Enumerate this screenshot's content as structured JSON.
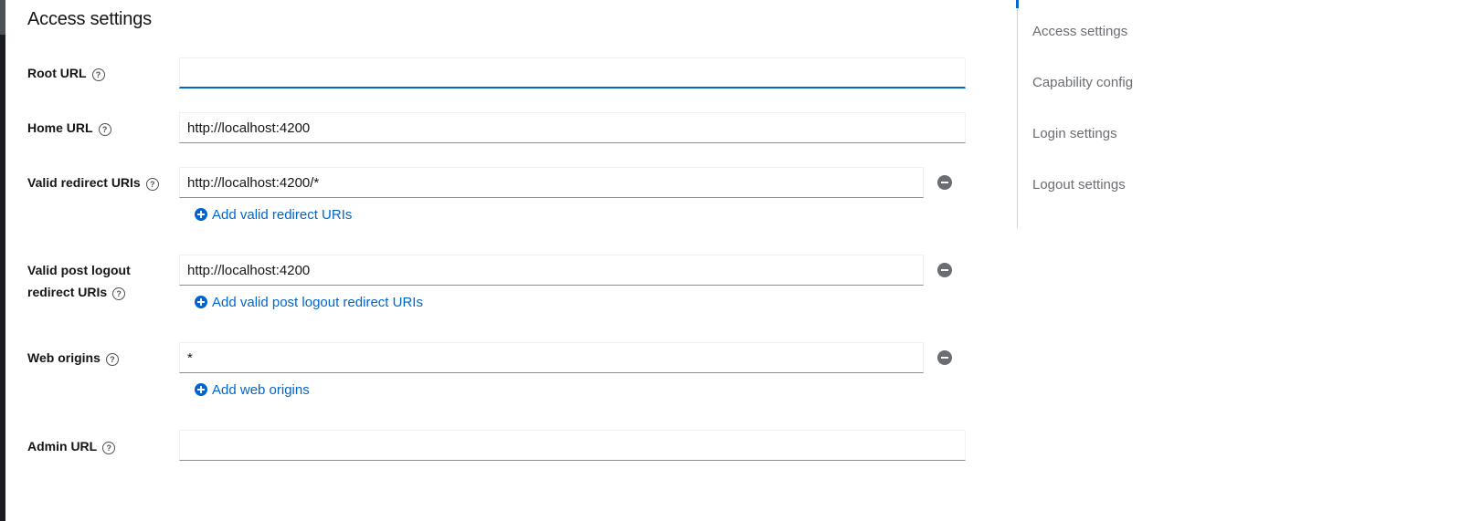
{
  "section": {
    "title": "Access settings"
  },
  "fields": {
    "root_url": {
      "label": "Root URL",
      "value": ""
    },
    "home_url": {
      "label": "Home URL",
      "value": "http://localhost:4200"
    },
    "redirect_uris": {
      "label": "Valid redirect URIs",
      "value": "http://localhost:4200/*",
      "add_label": "Add valid redirect URIs"
    },
    "post_logout": {
      "label_line1": "Valid post logout",
      "label_line2": "redirect URIs",
      "value": "http://localhost:4200",
      "add_label": "Add valid post logout redirect URIs"
    },
    "web_origins": {
      "label": "Web origins",
      "value": "*",
      "add_label": "Add web origins"
    },
    "admin_url": {
      "label": "Admin URL",
      "value": ""
    }
  },
  "jump_nav": {
    "items": [
      "Access settings",
      "Capability config",
      "Login settings",
      "Logout settings"
    ]
  },
  "colors": {
    "link": "#0066cc",
    "muted_text": "#6a6e73",
    "input_border": "#8a8d90"
  },
  "icons": {
    "help": "question-circle-icon",
    "add": "plus-circle-icon",
    "remove": "minus-circle-icon"
  }
}
